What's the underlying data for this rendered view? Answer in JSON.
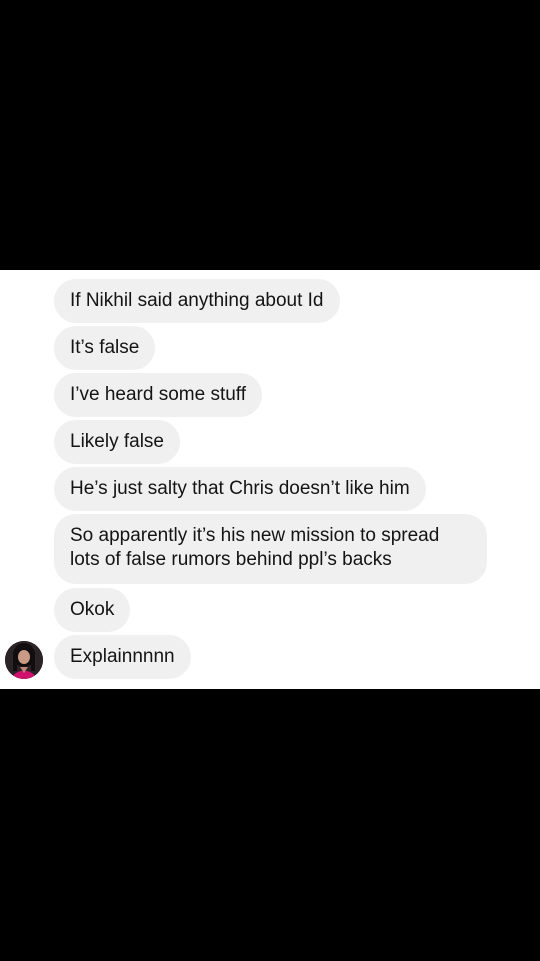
{
  "conversation": {
    "messages": [
      {
        "text": "If Nikhil said anything about Id"
      },
      {
        "text": "It’s false"
      },
      {
        "text": "I’ve heard some stuff"
      },
      {
        "text": "Likely false"
      },
      {
        "text": "He’s just salty that Chris doesn’t like him"
      },
      {
        "text": "So apparently it’s his new mission to spread lots of false rumors behind ppl’s backs"
      },
      {
        "text": "Okok"
      },
      {
        "text": "Explainnnnn"
      }
    ],
    "sender_avatar_icon": "profile-photo"
  },
  "colors": {
    "bubble_background": "#f1f0f0",
    "bubble_text": "#141414",
    "panel_background": "#ffffff",
    "letterbox": "#000000"
  }
}
